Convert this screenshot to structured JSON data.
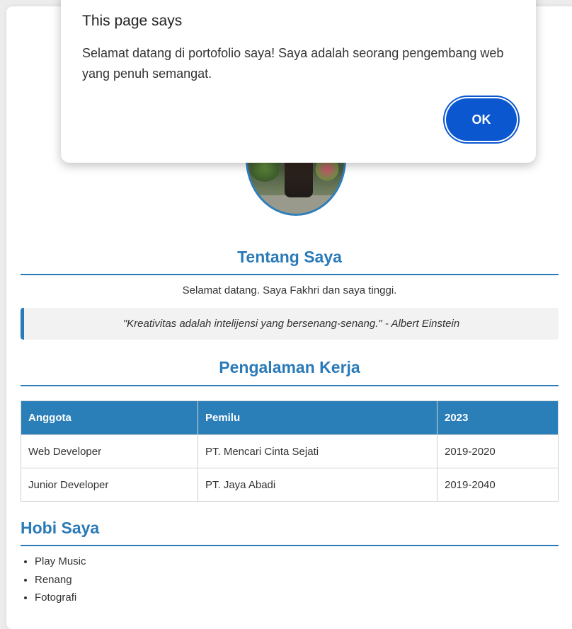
{
  "dialog": {
    "title": "This page says",
    "message": "Selamat datang di portofolio saya! Saya adalah seorang pengembang web yang penuh semangat.",
    "ok_label": "OK"
  },
  "about": {
    "title": "Tentang Saya",
    "text": "Selamat datang. Saya Fakhri dan saya tinggi.",
    "quote": "\"Kreativitas adalah intelijensi yang bersenang-senang.\" - Albert Einstein"
  },
  "experience": {
    "title": "Pengalaman Kerja",
    "headers": [
      "Anggota",
      "Pemilu",
      "2023"
    ],
    "rows": [
      [
        "Web Developer",
        "PT. Mencari Cinta Sejati",
        "2019-2020"
      ],
      [
        "Junior Developer",
        "PT. Jaya Abadi",
        "2019-2040"
      ]
    ]
  },
  "hobbies": {
    "title": "Hobi Saya",
    "items": [
      "Play Music",
      "Renang",
      "Fotografi"
    ]
  },
  "colors": {
    "accent": "#2a7ab8",
    "table_header": "#2a7fb9",
    "dialog_button": "#0b57d0"
  }
}
